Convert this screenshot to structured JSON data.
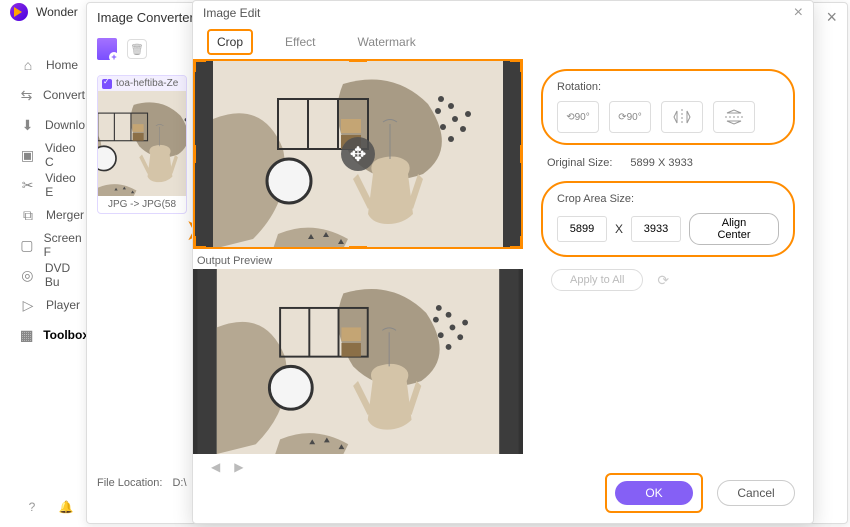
{
  "app": {
    "title": "Wonder"
  },
  "sidebar": {
    "items": [
      {
        "icon": "⌂",
        "label": "Home"
      },
      {
        "icon": "⇆",
        "label": "Convert"
      },
      {
        "icon": "⬇",
        "label": "Downlo"
      },
      {
        "icon": "▣",
        "label": "Video C"
      },
      {
        "icon": "✂",
        "label": "Video E"
      },
      {
        "icon": "⧉",
        "label": "Merger"
      },
      {
        "icon": "▢",
        "label": "Screen F"
      },
      {
        "icon": "◎",
        "label": "DVD Bu"
      },
      {
        "icon": "▷",
        "label": "Player"
      },
      {
        "icon": "▦",
        "label": "Toolbox"
      }
    ]
  },
  "converter": {
    "title": "Image Converter",
    "thumb_filename": "toa-heftiba-Ze",
    "thumb_format": "JPG -> JPG(58",
    "file_location_label": "File Location:",
    "file_location_value": "D:\\"
  },
  "edit": {
    "title": "Image Edit",
    "tabs": {
      "crop": "Crop",
      "effect": "Effect",
      "watermark": "Watermark"
    },
    "output_preview": "Output Preview",
    "rotation_label": "Rotation:",
    "rot_btn1": "⟲90°",
    "rot_btn2": "⟳90°",
    "original_size_label": "Original Size:",
    "original_size_value": "5899 X 3933",
    "crop_area_label": "Crop Area Size:",
    "crop_w": "5899",
    "crop_sep": "X",
    "crop_h": "3933",
    "align_center": "Align Center",
    "apply_all": "Apply to All",
    "ok": "OK",
    "cancel": "Cancel"
  }
}
